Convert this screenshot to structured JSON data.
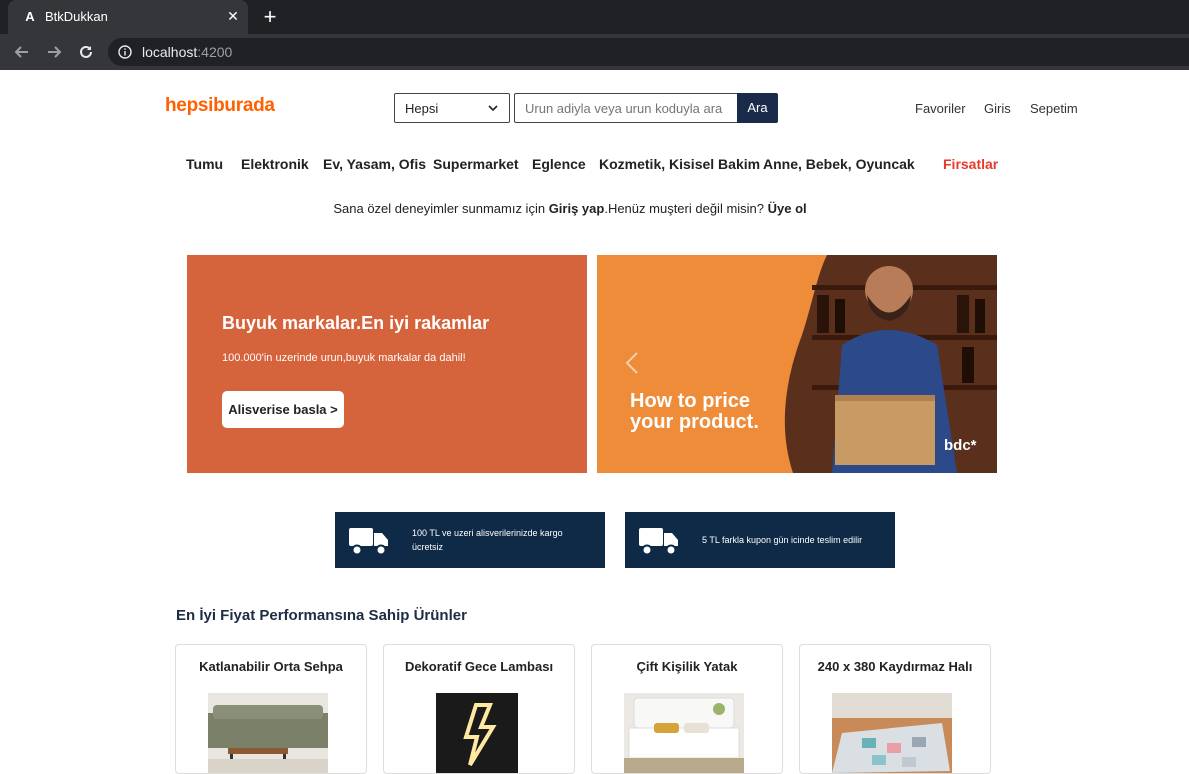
{
  "browser": {
    "tab_title": "BtkDukkan",
    "url_host": "localhost",
    "url_port": ":4200"
  },
  "header": {
    "logo": "hepsiburada",
    "category_select": "Hepsi",
    "search_placeholder": "Urun adiyla veya urun koduyla ara",
    "search_button": "Ara",
    "links": [
      "Favoriler",
      "Giris",
      "Sepetim"
    ]
  },
  "menu": {
    "items": [
      "Tumu",
      "Elektronik",
      "Ev, Yasam, Ofis",
      "Supermarket",
      "Eglence",
      "Kozmetik, Kisisel Bakim",
      "Anne, Bebek, Oyuncak"
    ],
    "deals": "Firsatlar"
  },
  "login_prompt": {
    "prefix": "Sana özel deneyimler sunmamız için ",
    "login_link": "Giriş yap",
    "middle": ".Henüz muşteri değil misin? ",
    "signup_link": "Üye ol"
  },
  "banners": {
    "left": {
      "title": "Buyuk markalar.En iyi rakamlar",
      "subtitle": "100.000'in uzerinde urun,buyuk markalar da dahil!",
      "cta": "Alisverise basla >"
    },
    "right": {
      "line1": "How to price",
      "line2": "your product.",
      "brand": "bdc*"
    }
  },
  "info_boxes": [
    {
      "text": "100 TL ve uzeri alisverilerinizde kargo ücretsiz",
      "icon": "truck-icon"
    },
    {
      "text": "5 TL farkla kupon gün icinde teslim edilir",
      "icon": "truck-icon"
    }
  ],
  "section_title": "En İyi Fiyat Performansına Sahip Ürünler",
  "products": [
    {
      "title": "Katlanabilir Orta Sehpa"
    },
    {
      "title": "Dekoratif Gece Lambası"
    },
    {
      "title": "Çift Kişilik Yatak"
    },
    {
      "title": "240 x 380 Kaydırmaz Halı"
    }
  ],
  "colors": {
    "brand_orange": "#ff6000",
    "navy": "#0e2a47",
    "deals_red": "#e63a2e",
    "banner_left": "#d5633c",
    "banner_right": "#ef8c3a"
  }
}
